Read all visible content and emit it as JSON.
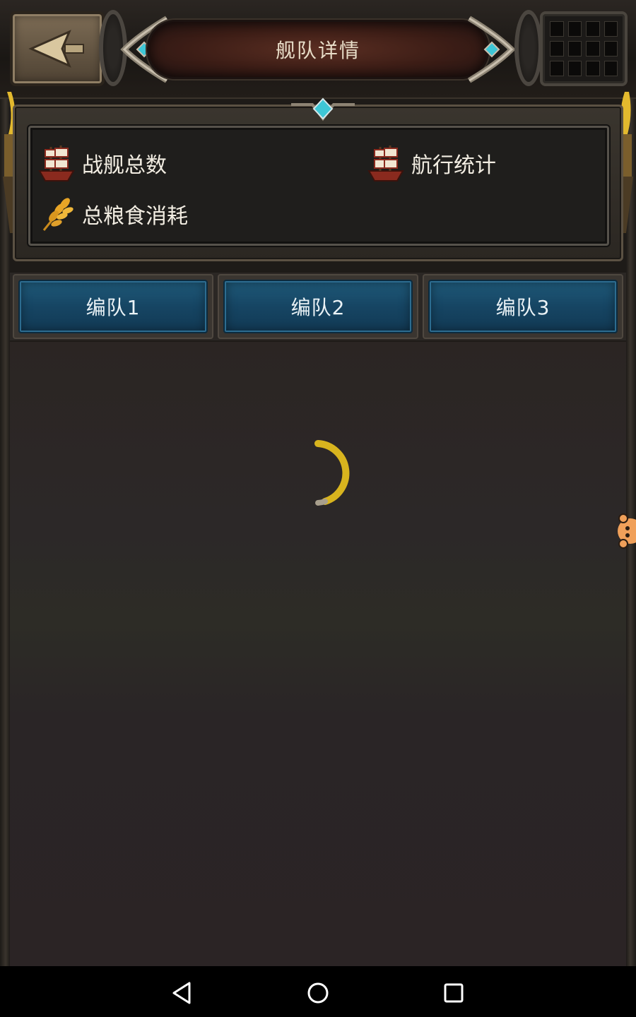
{
  "header": {
    "title": "舰队详情",
    "back_icon": "back-arrow-icon",
    "menu_icon": "grid-icon"
  },
  "stats": {
    "total_warships_label": "战舰总数",
    "voyage_stats_label": "航行统计",
    "food_consumption_label": "总粮食消耗"
  },
  "tabs": [
    {
      "label": "编队1"
    },
    {
      "label": "编队2"
    },
    {
      "label": "编队3"
    }
  ],
  "colors": {
    "tab_blue": "#164563",
    "title_plate": "#3c1d16",
    "spinner": "#d8b41e",
    "floating_icon": "#f0a05a"
  },
  "navbar": {
    "back": "nav-back-icon",
    "home": "nav-home-icon",
    "recents": "nav-recents-icon"
  }
}
